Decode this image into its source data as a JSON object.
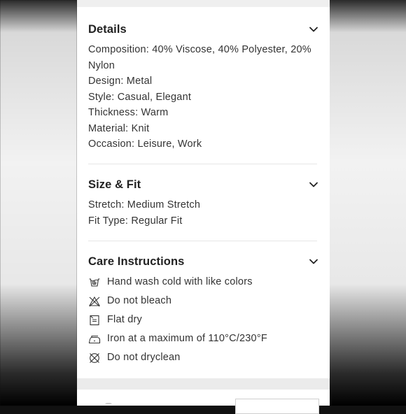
{
  "details": {
    "title": "Details",
    "lines": [
      "Composition: 40% Viscose, 40% Polyester, 20%",
      "Nylon",
      "Design: Metal",
      "Style: Casual, Elegant",
      "Thickness: Warm",
      "Material: Knit",
      "Occasion: Leisure, Work"
    ]
  },
  "size_fit": {
    "title": "Size & Fit",
    "lines": [
      "Stretch: Medium Stretch",
      "Fit Type: Regular Fit"
    ]
  },
  "care": {
    "title": "Care Instructions",
    "items": [
      {
        "icon": "hand-wash-icon",
        "text": "Hand wash cold with like colors"
      },
      {
        "icon": "no-bleach-icon",
        "text": "Do not bleach"
      },
      {
        "icon": "flat-dry-icon",
        "text": "Flat dry"
      },
      {
        "icon": "iron-icon",
        "text": "Iron at a maximum of 110°C/230°F"
      },
      {
        "icon": "no-dryclean-icon",
        "text": "Do not dryclean"
      }
    ]
  },
  "colors": {
    "text": "#333333",
    "title": "#222222",
    "divider": "#e6e6e6",
    "card": "#ffffff",
    "page_bg": "#efefef"
  }
}
